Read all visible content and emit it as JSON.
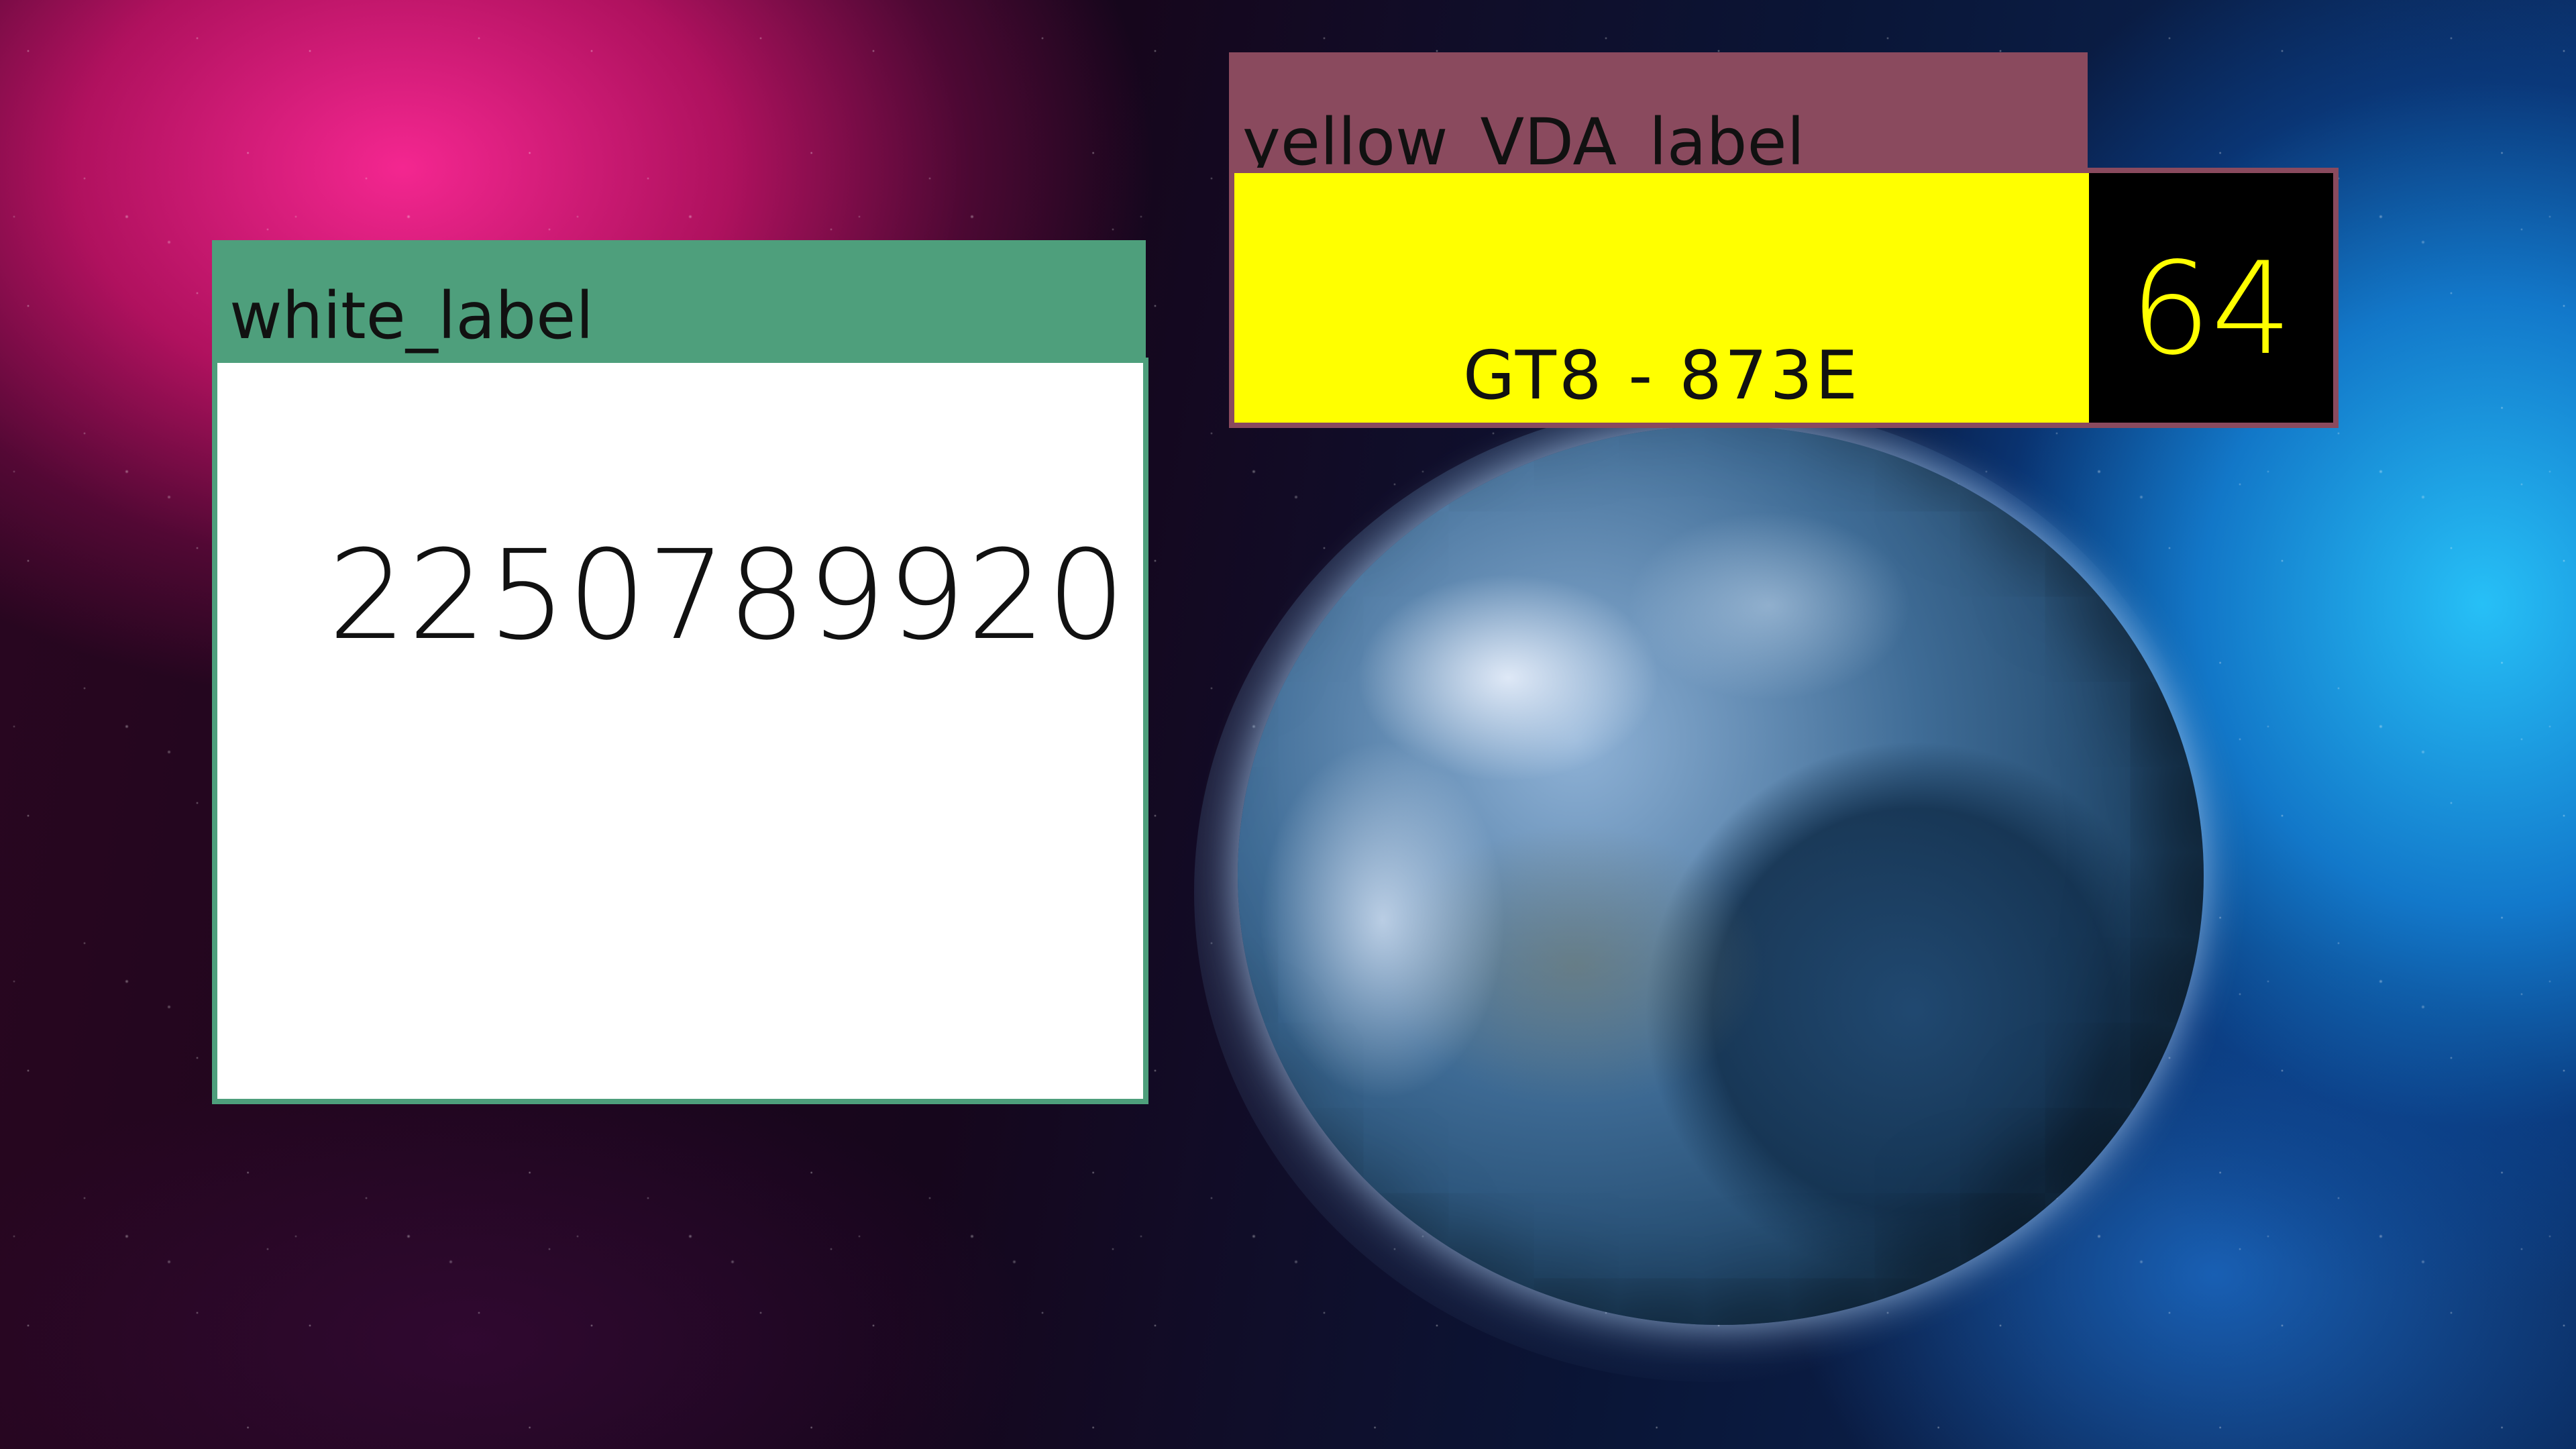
{
  "background": {
    "scene": "space-nebula",
    "planet": "earth-like-planet"
  },
  "white_widget": {
    "header_label": "white_label",
    "value": "2250789920",
    "accent_color": "#4e9f7c",
    "body_color": "#ffffff"
  },
  "yellow_widget": {
    "header_label": "yellow_VDA_label",
    "field_text": "GT8 - 873E",
    "number": "64",
    "accent_color": "#8a4a5e",
    "field_color": "#ffff00",
    "number_bg_color": "#000000",
    "number_color": "#ffff00"
  }
}
